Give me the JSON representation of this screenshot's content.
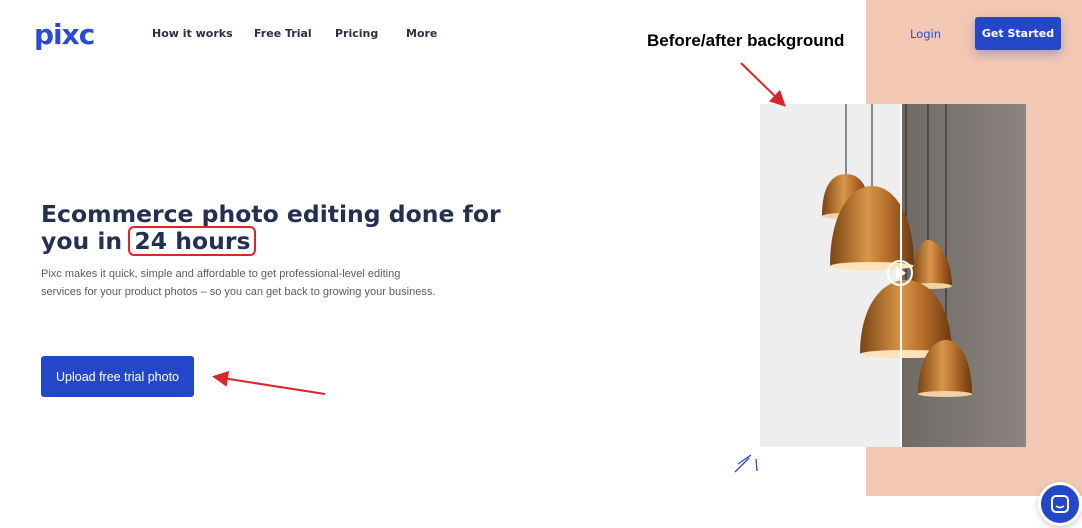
{
  "header": {
    "logo": "pixc",
    "nav": [
      "How it works",
      "Free Trial",
      "Pricing",
      "More"
    ],
    "login": "Login",
    "cta": "Get Started"
  },
  "annotation": {
    "label": "Before/after background"
  },
  "hero": {
    "title_part1": "Ecommerce photo editing done for you in",
    "title_highlight": "24 hours",
    "subtitle": "Pixc makes it quick, simple and affordable to get professional-level editing services for your product photos – so you can get back to growing your business.",
    "upload_button": "Upload free trial photo"
  },
  "image": {
    "description_icon": "lamp-photo",
    "slider_icon": "play-handle-icon"
  },
  "chat": {
    "icon": "chat-icon"
  },
  "colors": {
    "brand": "#2447c9",
    "peach": "#f3c8b2",
    "annotation_red": "#d9262c"
  }
}
